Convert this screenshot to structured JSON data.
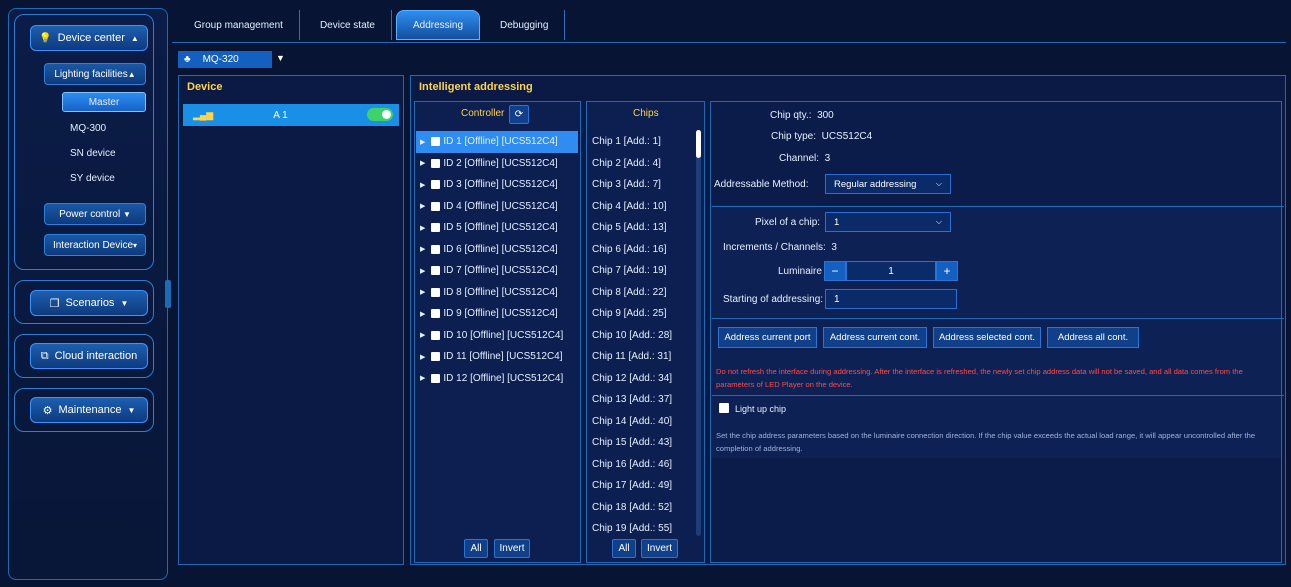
{
  "sidebar": {
    "device_center": "Device center",
    "lighting_facilities": "Lighting facilities",
    "leaves": [
      "Master",
      "MQ-300",
      "SN device",
      "SY device"
    ],
    "power_control": "Power control",
    "interaction_device": "Interaction Device",
    "scenarios": "Scenarios",
    "cloud_interaction": "Cloud interaction",
    "maintenance": "Maintenance"
  },
  "tabs": [
    "Group management",
    "Device state",
    "Addressing",
    "Debugging"
  ],
  "device_selector": "MQ-320",
  "device_panel": {
    "title": "Device",
    "row_label": "A 1"
  },
  "addressing": {
    "title": "Intelligent addressing",
    "controller_header": "Controller",
    "chips_header": "Chips",
    "controllers": [
      "ID 1 [Offline] [UCS512C4]",
      "ID 2 [Offline] [UCS512C4]",
      "ID 3 [Offline] [UCS512C4]",
      "ID 4 [Offline] [UCS512C4]",
      "ID 5 [Offline] [UCS512C4]",
      "ID 6 [Offline] [UCS512C4]",
      "ID 7 [Offline] [UCS512C4]",
      "ID 8 [Offline] [UCS512C4]",
      "ID 9 [Offline] [UCS512C4]",
      "ID 10 [Offline] [UCS512C4]",
      "ID 11 [Offline] [UCS512C4]",
      "ID 12 [Offline] [UCS512C4]"
    ],
    "chips": [
      "Chip 1 [Add.: 1]",
      "Chip 2 [Add.: 4]",
      "Chip 3 [Add.: 7]",
      "Chip 4 [Add.: 10]",
      "Chip 5 [Add.: 13]",
      "Chip 6 [Add.: 16]",
      "Chip 7 [Add.: 19]",
      "Chip 8 [Add.: 22]",
      "Chip 9 [Add.: 25]",
      "Chip 10 [Add.: 28]",
      "Chip 11 [Add.: 31]",
      "Chip 12 [Add.: 34]",
      "Chip 13 [Add.: 37]",
      "Chip 14 [Add.: 40]",
      "Chip 15 [Add.: 43]",
      "Chip 16 [Add.: 46]",
      "Chip 17 [Add.: 49]",
      "Chip 18 [Add.: 52]",
      "Chip 19 [Add.: 55]"
    ],
    "all_label": "All",
    "invert_label": "Invert"
  },
  "settings": {
    "chip_qty_label": "Chip qty.:",
    "chip_qty": "300",
    "chip_type_label": "Chip type:",
    "chip_type": "UCS512C4",
    "channel_label": "Channel:",
    "channel": "3",
    "method_label": "Addressable Method:",
    "method": "Regular addressing",
    "pixel_label": "Pixel of a chip:",
    "pixel": "1",
    "increments_label": "Increments / Channels:",
    "increments": "3",
    "luminaire_label": "Luminaire",
    "luminaire": "1",
    "start_label": "Starting of addressing:",
    "start": "1",
    "buttons": [
      "Address current port",
      "Address current cont.",
      "Address selected cont.",
      "Address all cont."
    ],
    "warning": "Do not refresh the interface during addressing. After the interface is refreshed, the newly set chip address data will not be saved, and all data comes from the parameters of LED Player on the device.",
    "light_up_label": "Light up chip",
    "note": "Set the chip address parameters based on the luminaire connection direction. If the chip value exceeds the actual load range, it will appear uncontrolled after the completion of addressing."
  }
}
